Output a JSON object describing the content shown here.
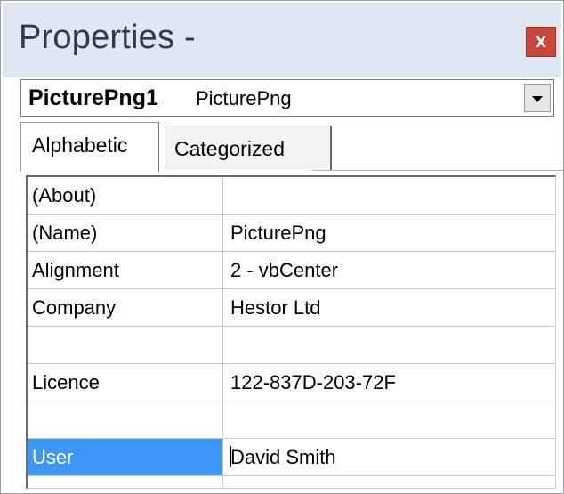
{
  "window": {
    "title": "Properties -",
    "close_label": "x"
  },
  "object_selector": {
    "name": "PicturePng1",
    "type": "PicturePng"
  },
  "tabs": [
    {
      "label": "Alphabetic",
      "active": true
    },
    {
      "label": "Categorized",
      "active": false
    }
  ],
  "properties": [
    {
      "name": "(About)",
      "value": ""
    },
    {
      "name": "(Name)",
      "value": "PicturePng"
    },
    {
      "name": "Alignment",
      "value": "2 - vbCenter"
    },
    {
      "name": "Company",
      "value": "Hestor Ltd"
    },
    {
      "name": "",
      "value": ""
    },
    {
      "name": "Licence",
      "value": "122-837D-203-72F"
    },
    {
      "name": "",
      "value": ""
    },
    {
      "name": "User",
      "value": "David Smith",
      "selected": true
    },
    {
      "name": "",
      "value": ""
    }
  ],
  "colors": {
    "titlebar": "#dde8f2",
    "close_button": "#c9463c",
    "selection": "#3d97f5"
  }
}
